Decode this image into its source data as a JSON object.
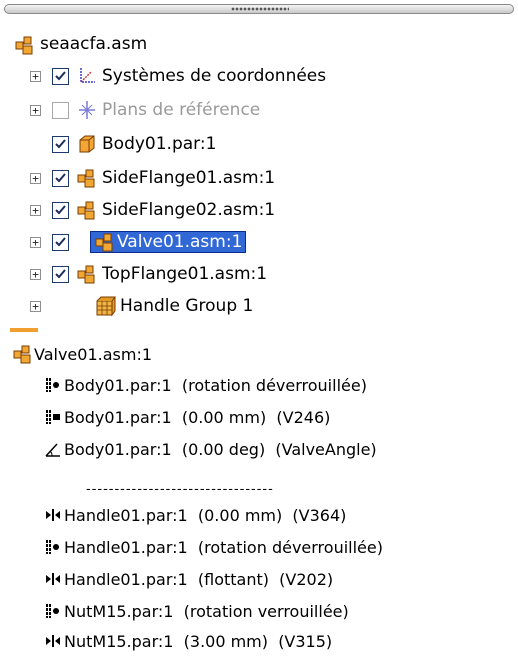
{
  "tree": {
    "root_label": "seaacfa.asm",
    "items": [
      {
        "label": "Systèmes de coordonnées",
        "checked": true,
        "enabled": true,
        "icon": "coordinate-systems-icon"
      },
      {
        "label": "Plans de référence",
        "checked": false,
        "enabled": false,
        "icon": "reference-planes-icon"
      },
      {
        "label": "Body01.par:1",
        "checked": true,
        "enabled": true,
        "icon": "part-icon"
      },
      {
        "label": "SideFlange01.asm:1",
        "checked": true,
        "enabled": true,
        "icon": "assembly-icon"
      },
      {
        "label": "SideFlange02.asm:1",
        "checked": true,
        "enabled": true,
        "icon": "assembly-icon"
      },
      {
        "label": "Valve01.asm:1",
        "checked": true,
        "enabled": true,
        "selected": true,
        "icon": "assembly-icon"
      },
      {
        "label": "TopFlange01.asm:1",
        "checked": true,
        "enabled": true,
        "icon": "assembly-icon"
      },
      {
        "label": "Handle Group 1",
        "checked": null,
        "enabled": true,
        "icon": "group-icon"
      }
    ]
  },
  "relationships": {
    "header": "Valve01.asm:1",
    "items": [
      {
        "part": "Body01.par:1",
        "detail": "(rotation déverrouillée)",
        "extra": "",
        "icon": "axial-align-icon"
      },
      {
        "part": "Body01.par:1",
        "detail": "(0.00 mm)",
        "extra": "(V246)",
        "icon": "planar-align-icon"
      },
      {
        "part": "Body01.par:1",
        "detail": "(0.00 deg)",
        "extra": "(ValveAngle)",
        "icon": "angle-icon"
      },
      {
        "part": "Handle01.par:1",
        "detail": "(0.00 mm)",
        "extra": "(V364)",
        "icon": "mate-icon"
      },
      {
        "part": "Handle01.par:1",
        "detail": "(rotation déverrouillée)",
        "extra": "",
        "icon": "axial-align-icon"
      },
      {
        "part": "Handle01.par:1",
        "detail": "(flottant)",
        "extra": "(V202)",
        "icon": "mate-icon"
      },
      {
        "part": "NutM15.par:1",
        "detail": "(rotation verrouillée)",
        "extra": "",
        "icon": "axial-align-icon"
      },
      {
        "part": "NutM15.par:1",
        "detail": "(3.00 mm)",
        "extra": "(V315)",
        "icon": "mate-icon"
      }
    ],
    "separator": "---------------------------------"
  },
  "colors": {
    "selection": "#3168d5",
    "accent": "#f0a030",
    "assembly_icon": "#e8a020"
  }
}
